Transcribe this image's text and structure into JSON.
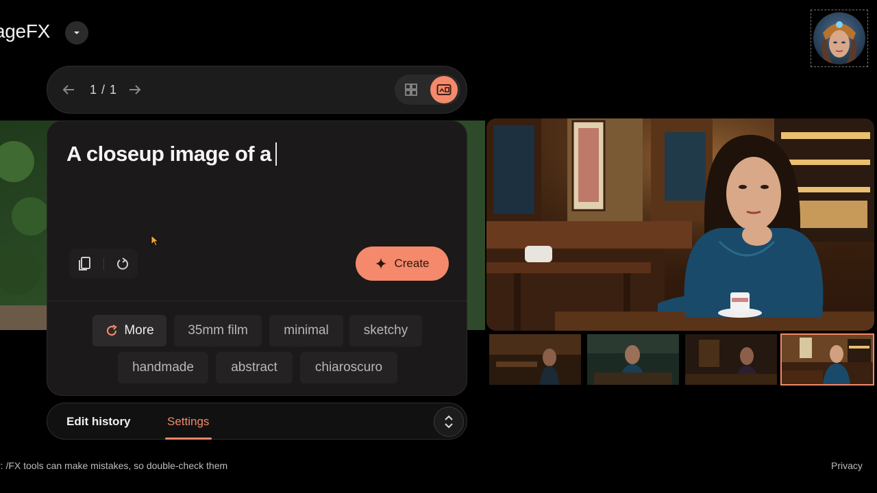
{
  "header": {
    "brand": "ageFX",
    "brand_dropdown_icon": "chevron-down-icon"
  },
  "nav": {
    "prev_icon": "arrow-left-icon",
    "count": "1 / 1",
    "next_icon": "arrow-right-icon",
    "grid_icon": "grid-view-icon",
    "single_icon": "single-view-icon"
  },
  "prompt": {
    "text": "A closeup image of a"
  },
  "tools": {
    "copy_icon": "copy-icon",
    "reset_icon": "reset-icon"
  },
  "create": {
    "label": "Create",
    "icon": "sparkle-icon"
  },
  "chips": [
    {
      "label": "More",
      "icon": "refresh-icon"
    },
    {
      "label": "35mm film"
    },
    {
      "label": "minimal"
    },
    {
      "label": "sketchy"
    },
    {
      "label": "handmade"
    },
    {
      "label": "abstract"
    },
    {
      "label": "chiaroscuro"
    }
  ],
  "tabs": {
    "history": "Edit history",
    "settings": "Settings",
    "active": "Settings",
    "expand_icon": "expand-icon"
  },
  "footer": {
    "disclaimer": "r: /FX tools can make mistakes, so double-check them",
    "privacy": "Privacy"
  },
  "colors": {
    "accent": "#f4896b",
    "background": "#000000",
    "card": "#1b1919"
  }
}
